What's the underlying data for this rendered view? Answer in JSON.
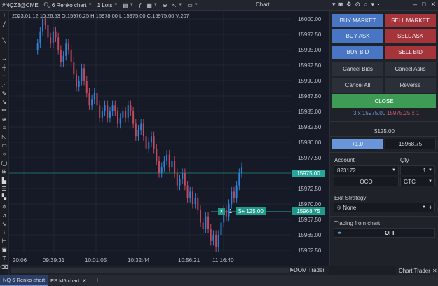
{
  "toolbar": {
    "instrument": "#NQZ3@CME",
    "chart_type": "6 Renko chart",
    "lots": "1 Lots",
    "window_title": "Chart"
  },
  "chart": {
    "ohlc_line": "2023.01.12 10:26:53 O:15976.25 H:15978.00 L:15975.00 C:15975.00 V:207",
    "price_ticks": [
      "16000.00",
      "15997.50",
      "15995.00",
      "15992.50",
      "15990.00",
      "15987.50",
      "15985.00",
      "15982.50",
      "15980.00",
      "15977.50",
      "15975.00",
      "15972.50",
      "15970.00",
      "15967.50",
      "15965.00",
      "15962.50"
    ],
    "time_ticks": [
      "20:06",
      "09:39:31",
      "10:01:05",
      "10:32:44",
      "10:56:21",
      "11:16:40"
    ],
    "current_price_tag": "15975.00",
    "position_price_tag": "15968.75",
    "position_qty": "1",
    "position_pnl": "$+ 125.00",
    "position_close_symbol": "✕",
    "colors": {
      "up": "#2f82d6",
      "down": "#c0485f",
      "background": "#151a26"
    }
  },
  "chart_bottom": {
    "dom_trader_tab": "DOM Trader",
    "chart_trader_tab": "Chart Trader"
  },
  "trader": {
    "buy_market": "BUY MARKET",
    "sell_market": "SELL MARKET",
    "buy_ask": "BUY ASK",
    "sell_ask": "SELL ASK",
    "buy_bid": "BUY BID",
    "sell_bid": "SELL BID",
    "cancel_bids": "Cancel Bids",
    "cancel_asks": "Cancel Asks",
    "cancel_all": "Cancel All",
    "reverse": "Reverse",
    "close": "CLOSE",
    "position_buy": "3 x 15975.00",
    "position_sell": "15975.25 x 1",
    "pnl": "$125.00",
    "offset_button": "+1.0",
    "offset_price": "15968.75",
    "account_label": "Account",
    "account_value": "823172",
    "qty_label": "Qty",
    "qty_value": "1",
    "oco": "OCO",
    "tif": "GTC",
    "exit_strategy_label": "Exit Strategy",
    "exit_strategy_value": "None",
    "trading_from_chart_label": "Trading from chart",
    "trading_from_chart_state": "OFF"
  },
  "tabs": [
    {
      "label": "NQ 6 Renko chart",
      "active": true
    },
    {
      "label": "ES M5 chart",
      "active": false
    }
  ]
}
